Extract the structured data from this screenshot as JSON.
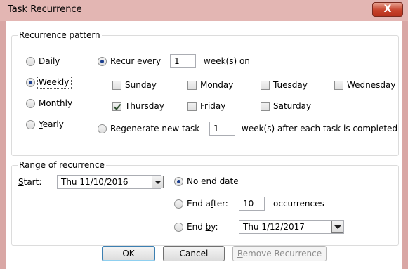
{
  "window": {
    "title": "Task Recurrence",
    "close_symbol": "X"
  },
  "pattern": {
    "group_title": "Recurrence pattern",
    "frequencies": [
      {
        "label": "Daily",
        "accel": "D",
        "rest": "aily",
        "selected": false
      },
      {
        "label": "Weekly",
        "accel": "W",
        "rest": "eekly",
        "selected": true
      },
      {
        "label": "Monthly",
        "accel": "M",
        "rest": "onthly",
        "selected": false
      },
      {
        "label": "Yearly",
        "accel": "Y",
        "rest": "early",
        "selected": false
      }
    ],
    "recur_every": {
      "pre": "Re",
      "accel": "c",
      "post": "ur every",
      "value": "1",
      "suffix": "week(s) on",
      "selected": true
    },
    "days": [
      {
        "label": "Sunday",
        "checked": false
      },
      {
        "label": "Monday",
        "checked": false
      },
      {
        "label": "Tuesday",
        "checked": false
      },
      {
        "label": "Wednesday",
        "checked": false
      },
      {
        "label": "Thursday",
        "checked": true
      },
      {
        "label": "Friday",
        "checked": false
      },
      {
        "label": "Saturday",
        "checked": false
      }
    ],
    "regenerate": {
      "pre": "Re",
      "accel": "g",
      "post": "enerate new task",
      "value": "1",
      "suffix": "week(s) after each task is completed",
      "selected": false
    }
  },
  "range": {
    "group_title": "Range of recurrence",
    "start": {
      "accel": "S",
      "rest": "tart:",
      "value": "Thu 11/10/2016"
    },
    "no_end": {
      "pre": "N",
      "accel": "o",
      "post": " end date",
      "selected": true
    },
    "end_after": {
      "pre": "End a",
      "accel": "f",
      "post": "ter:",
      "value": "10",
      "suffix": "occurrences",
      "selected": false
    },
    "end_by": {
      "pre": "End ",
      "accel": "b",
      "post": "y:",
      "value": "Thu 1/12/2017",
      "selected": false
    }
  },
  "buttons": {
    "ok": "OK",
    "cancel": "Cancel",
    "remove": {
      "accel": "R",
      "rest": "emove Recurrence"
    }
  }
}
